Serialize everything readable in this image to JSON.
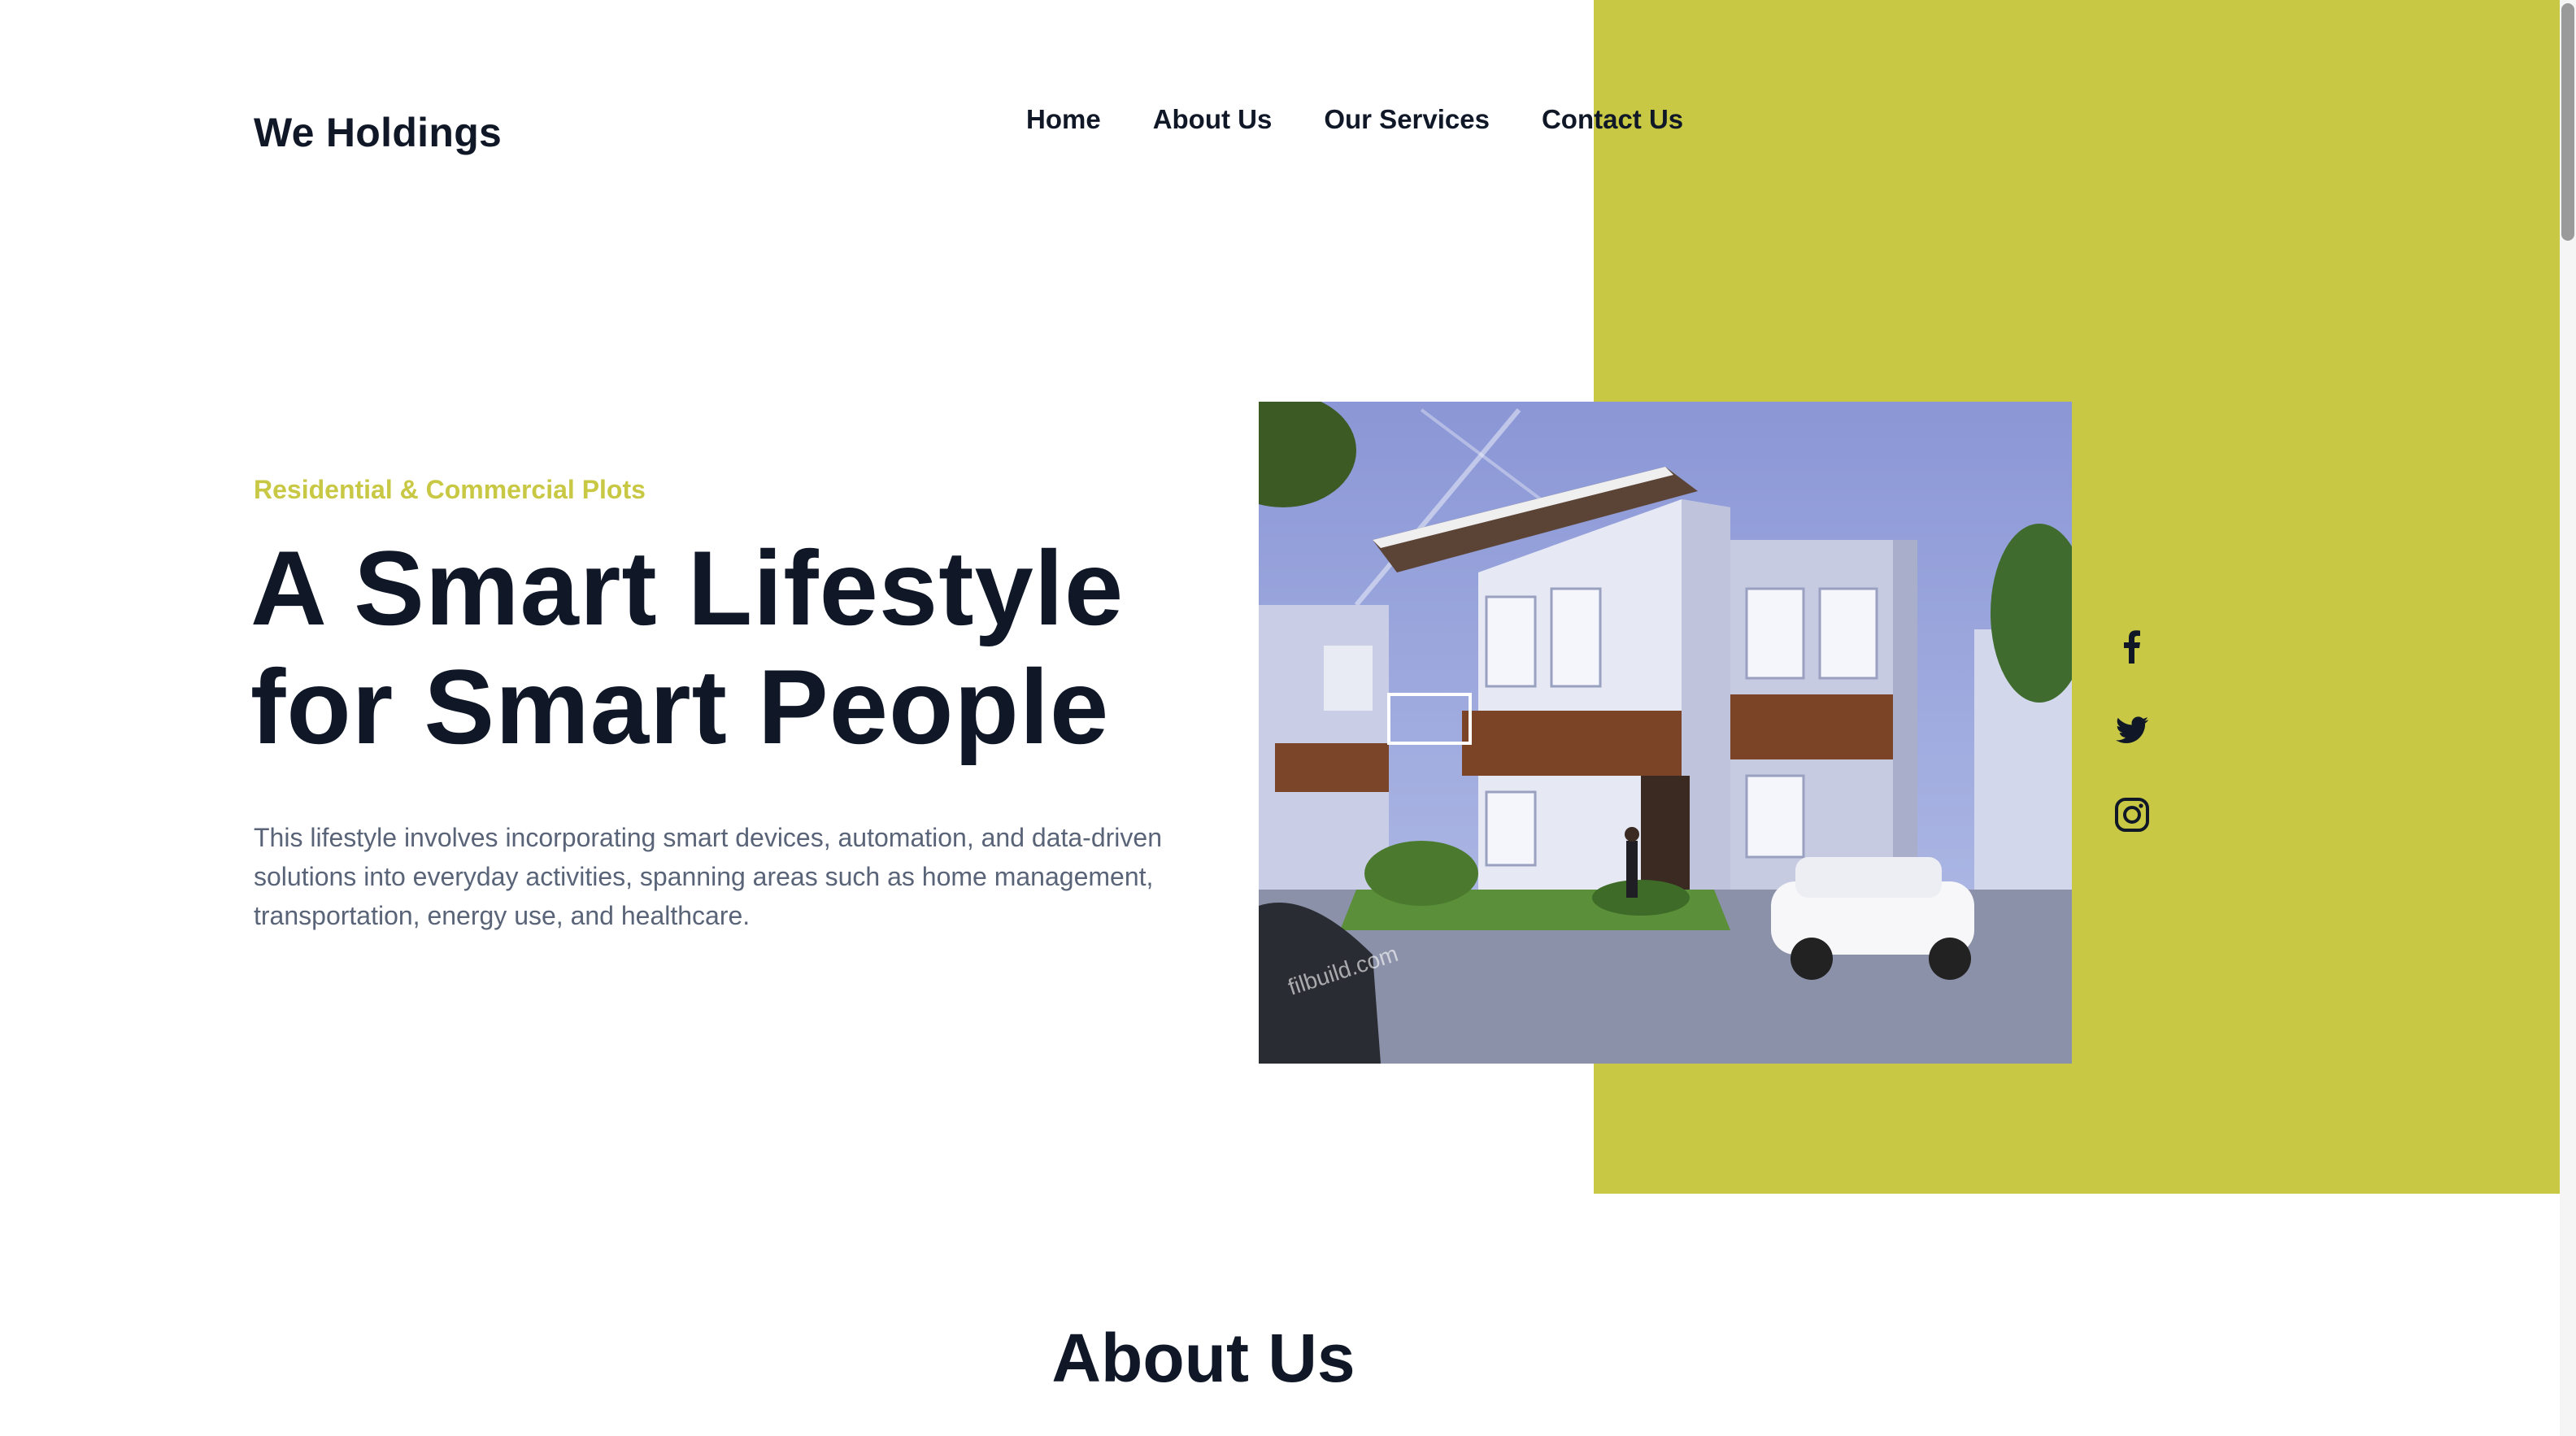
{
  "brand": {
    "name": "We Holdings"
  },
  "nav": {
    "items": [
      {
        "label": "Home"
      },
      {
        "label": "About Us"
      },
      {
        "label": "Our Services"
      },
      {
        "label": "Contact Us"
      }
    ]
  },
  "hero": {
    "eyebrow": "Residential & Commercial Plots",
    "headline_line1": "A Smart Lifestyle",
    "headline_line2": "for Smart People",
    "description": "This lifestyle involves incorporating smart devices, automation, and data-driven solutions into everyday activities, spanning areas such as home management, transportation, energy use, and healthcare.",
    "image": {
      "subject": "modern two-storey house with cars",
      "watermark": "filbuild.com"
    }
  },
  "social": {
    "items": [
      {
        "icon": "facebook-icon"
      },
      {
        "icon": "twitter-icon"
      },
      {
        "icon": "instagram-icon"
      }
    ]
  },
  "about": {
    "title": "About Us"
  },
  "colors": {
    "accent": "#c8c844",
    "text_dark": "#101828",
    "text_muted": "#5a6478",
    "background": "#ffffff"
  }
}
